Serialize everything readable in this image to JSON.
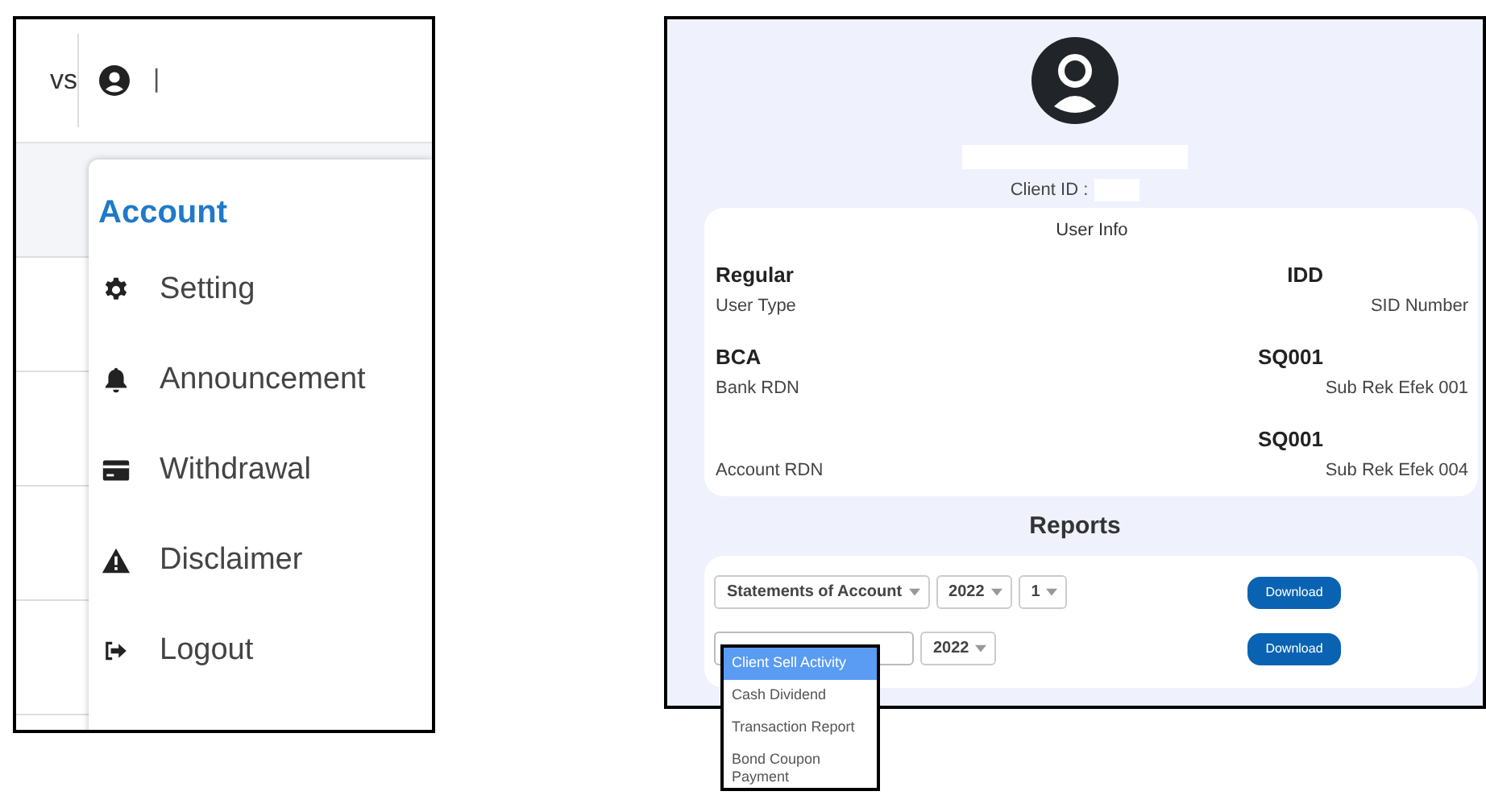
{
  "account_menu": {
    "top_bar": {
      "partial_text": "vs",
      "cursor": "|"
    },
    "title": "Account",
    "items": [
      {
        "label": "Setting"
      },
      {
        "label": "Announcement"
      },
      {
        "label": "Withdrawal"
      },
      {
        "label": "Disclaimer"
      },
      {
        "label": "Logout"
      }
    ]
  },
  "profile": {
    "client_id_label": "Client ID :",
    "user_info": {
      "title": "User Info",
      "fields": [
        {
          "value": "Regular",
          "label": "User Type"
        },
        {
          "value": "IDD",
          "label": "SID Number"
        },
        {
          "value": "BCA",
          "label": "Bank RDN"
        },
        {
          "value": "SQ001",
          "label": "Sub Rek Efek 001"
        },
        {
          "label": "Account RDN"
        },
        {
          "value": "SQ001",
          "label": "Sub Rek Efek 004"
        }
      ]
    },
    "reports": {
      "title": "Reports",
      "rows": [
        {
          "selects": [
            {
              "value": "Statements of Account",
              "open": false
            },
            {
              "value": "2022",
              "open": false
            },
            {
              "value": "1",
              "open": false
            }
          ],
          "button": "Download"
        },
        {
          "selects": [
            {
              "open": true
            },
            {
              "value": "2022",
              "open": false
            }
          ],
          "button": "Download",
          "options": [
            {
              "label": "Client Sell Activity",
              "selected": true
            },
            {
              "label": "Cash Dividend",
              "selected": false
            },
            {
              "label": "Transaction Report",
              "selected": false
            },
            {
              "label": "Bond Coupon Payment",
              "selected": false
            }
          ]
        }
      ]
    }
  }
}
